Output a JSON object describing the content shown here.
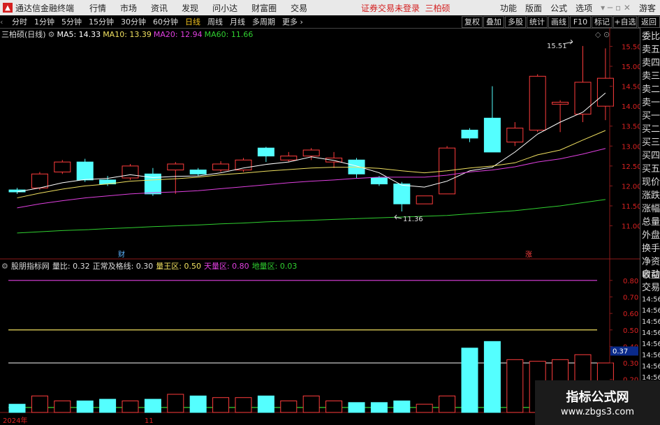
{
  "menubar": {
    "app_title": "通达信金融终端",
    "items": [
      "行情",
      "市场",
      "资讯",
      "发现",
      "问小达",
      "财富圈",
      "交易"
    ],
    "warning": "证券交易未登录",
    "warning_name": "三柏硕",
    "right_items": [
      "功能",
      "版面",
      "公式",
      "选项"
    ],
    "guest": "游客"
  },
  "toolbar": {
    "periods": [
      "分时",
      "1分钟",
      "5分钟",
      "15分钟",
      "30分钟",
      "60分钟",
      "日线",
      "周线",
      "月线",
      "多周期",
      "更多"
    ],
    "active_period": "日线",
    "buttons": [
      "复权",
      "叠加",
      "多股",
      "统计",
      "画线",
      "F10",
      "标记",
      "+自选",
      "返回"
    ]
  },
  "main_chart": {
    "stock": "三柏硕(日线)",
    "ma": [
      {
        "label": "MA5: 14.33",
        "color": "#ffffff"
      },
      {
        "label": "MA10: 13.39",
        "color": "#f0e060"
      },
      {
        "label": "MA20: 12.94",
        "color": "#e040e0"
      },
      {
        "label": "MA60: 11.66",
        "color": "#30d030"
      }
    ],
    "high_label": "15.51",
    "low_label": "11.36",
    "marker_cai": "财",
    "marker_zhang": "涨"
  },
  "chart_data": {
    "type": "candlestick",
    "ylim": [
      10.8,
      15.7
    ],
    "y_ticks": [
      "15.50",
      "15.00",
      "14.50",
      "14.00",
      "13.50",
      "13.00",
      "12.50",
      "12.00",
      "11.50",
      "11.00"
    ],
    "candles": [
      {
        "o": 11.9,
        "c": 11.85,
        "h": 11.95,
        "l": 11.8
      },
      {
        "o": 11.95,
        "c": 12.3,
        "h": 12.35,
        "l": 11.9
      },
      {
        "o": 12.35,
        "c": 12.6,
        "h": 12.65,
        "l": 12.3
      },
      {
        "o": 12.6,
        "c": 12.15,
        "h": 12.68,
        "l": 12.1
      },
      {
        "o": 12.15,
        "c": 12.05,
        "h": 12.25,
        "l": 12.0
      },
      {
        "o": 12.2,
        "c": 12.5,
        "h": 12.55,
        "l": 12.15
      },
      {
        "o": 12.3,
        "c": 11.8,
        "h": 12.45,
        "l": 11.75
      },
      {
        "o": 12.4,
        "c": 12.55,
        "h": 12.6,
        "l": 11.8
      },
      {
        "o": 12.4,
        "c": 12.3,
        "h": 12.45,
        "l": 12.25
      },
      {
        "o": 12.4,
        "c": 12.55,
        "h": 12.62,
        "l": 12.35
      },
      {
        "o": 12.4,
        "c": 12.65,
        "h": 12.7,
        "l": 12.35
      },
      {
        "o": 12.95,
        "c": 12.75,
        "h": 12.98,
        "l": 12.6
      },
      {
        "o": 12.65,
        "c": 12.75,
        "h": 12.85,
        "l": 12.6
      },
      {
        "o": 12.75,
        "c": 12.9,
        "h": 12.95,
        "l": 12.65
      },
      {
        "o": 12.6,
        "c": 12.7,
        "h": 12.85,
        "l": 12.45
      },
      {
        "o": 12.65,
        "c": 12.3,
        "h": 12.7,
        "l": 12.2
      },
      {
        "o": 12.2,
        "c": 12.05,
        "h": 12.25,
        "l": 12.0
      },
      {
        "o": 12.05,
        "c": 11.55,
        "h": 12.1,
        "l": 11.36
      },
      {
        "o": 11.55,
        "c": 11.75,
        "h": 11.75,
        "l": 11.55
      },
      {
        "o": 11.8,
        "c": 12.95,
        "h": 13.0,
        "l": 11.8
      },
      {
        "o": 13.4,
        "c": 13.2,
        "h": 13.45,
        "l": 13.1
      },
      {
        "o": 13.7,
        "c": 12.85,
        "h": 14.5,
        "l": 12.85
      },
      {
        "o": 13.1,
        "c": 13.45,
        "h": 13.6,
        "l": 13.0
      },
      {
        "o": 13.4,
        "c": 14.75,
        "h": 14.8,
        "l": 13.35
      },
      {
        "o": 14.05,
        "c": 14.1,
        "h": 14.15,
        "l": 13.35
      },
      {
        "o": 13.8,
        "c": 14.6,
        "h": 15.51,
        "l": 13.6
      },
      {
        "o": 14.0,
        "c": 14.7,
        "h": 15.45,
        "l": 13.65
      }
    ],
    "ma5": [
      11.85,
      11.95,
      12.08,
      12.16,
      12.19,
      12.28,
      12.21,
      12.24,
      12.25,
      12.33,
      12.45,
      12.54,
      12.6,
      12.73,
      12.64,
      12.5,
      12.33,
      12.02,
      11.97,
      12.12,
      12.38,
      12.47,
      12.85,
      13.3,
      13.6,
      13.85,
      14.33
    ],
    "ma10": [
      11.7,
      11.82,
      11.92,
      12.0,
      12.05,
      12.12,
      12.15,
      12.18,
      12.22,
      12.28,
      12.32,
      12.37,
      12.41,
      12.45,
      12.47,
      12.47,
      12.44,
      12.38,
      12.33,
      12.38,
      12.45,
      12.5,
      12.58,
      12.78,
      12.9,
      13.15,
      13.39
    ],
    "ma20": [
      11.45,
      11.55,
      11.63,
      11.7,
      11.75,
      11.8,
      11.83,
      11.85,
      11.88,
      11.93,
      11.98,
      12.03,
      12.08,
      12.12,
      12.15,
      12.19,
      12.22,
      12.22,
      12.22,
      12.27,
      12.35,
      12.4,
      12.48,
      12.6,
      12.68,
      12.8,
      12.94
    ],
    "ma60": [
      10.82,
      10.85,
      10.88,
      10.9,
      10.93,
      10.95,
      10.98,
      11.0,
      11.02,
      11.05,
      11.07,
      11.1,
      11.12,
      11.14,
      11.16,
      11.18,
      11.2,
      11.22,
      11.24,
      11.26,
      11.3,
      11.34,
      11.38,
      11.44,
      11.5,
      11.58,
      11.66
    ],
    "volume_panel": {
      "name": "股朋指标网",
      "legend": [
        {
          "label": "量比: 0.32",
          "color": "#dddddd"
        },
        {
          "label": "正常及格线: 0.30",
          "color": "#dddddd"
        },
        {
          "label": "量王区: 0.50",
          "color": "#f0e060"
        },
        {
          "label": "天量区: 0.80",
          "color": "#e040e0"
        },
        {
          "label": "地量区: 0.03",
          "color": "#30d030"
        }
      ],
      "ylim": [
        0.0,
        0.85
      ],
      "y_ticks": [
        "0.80",
        "0.70",
        "0.60",
        "0.50",
        "0.40",
        "0.30",
        "0.20"
      ],
      "current": "0.37",
      "lines": [
        0.8,
        0.5,
        0.3,
        0.03
      ],
      "values": [
        0.05,
        0.1,
        0.07,
        0.07,
        0.08,
        0.07,
        0.08,
        0.11,
        0.1,
        0.09,
        0.09,
        0.1,
        0.07,
        0.1,
        0.07,
        0.06,
        0.06,
        0.07,
        0.05,
        0.1,
        0.39,
        0.43,
        0.32,
        0.31,
        0.32,
        0.35,
        0.3
      ]
    },
    "x_labels": [
      "2024年",
      "11"
    ]
  },
  "right_panel": {
    "items": [
      "委比",
      "卖五",
      "卖四",
      "卖三",
      "卖二",
      "卖一",
      "买一",
      "买二",
      "买三",
      "买四",
      "买五",
      "现价",
      "涨跌",
      "涨幅",
      "总量",
      "外盘",
      "换手",
      "净资",
      "收益"
    ],
    "bottom_items": [
      "自动",
      "交易"
    ],
    "times": [
      "14:56",
      "14:56",
      "14:56",
      "14:56",
      "14:56",
      "14:56",
      "14:56",
      "14:56"
    ]
  },
  "watermark": {
    "title": "指标公式网",
    "url": "www.zbgs3.com"
  }
}
